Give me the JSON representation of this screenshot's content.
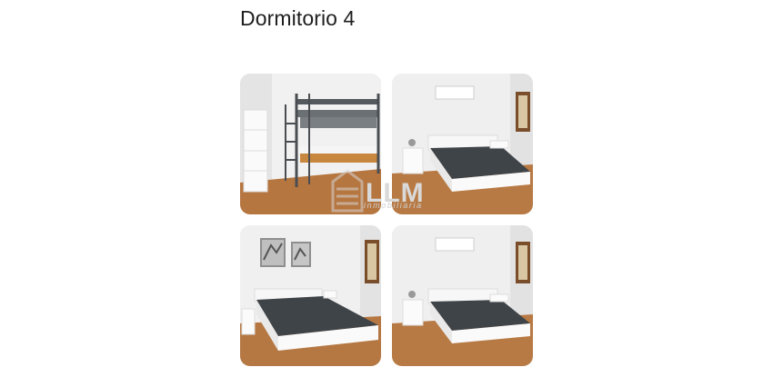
{
  "section": {
    "title": "Dormitorio 4"
  },
  "photos": [
    {
      "icon": "bunk-bed-photo"
    },
    {
      "icon": "double-bed-photo"
    },
    {
      "icon": "bed-with-paintings-photo"
    },
    {
      "icon": "double-bed-window-photo"
    }
  ],
  "watermark": {
    "brand": "LLM",
    "subtitle": "inmobiliaria"
  },
  "colors": {
    "title": "#1f1f1f",
    "wall": "#eeeeee",
    "floor": "#b9773f",
    "bedding": "#3f4448"
  }
}
